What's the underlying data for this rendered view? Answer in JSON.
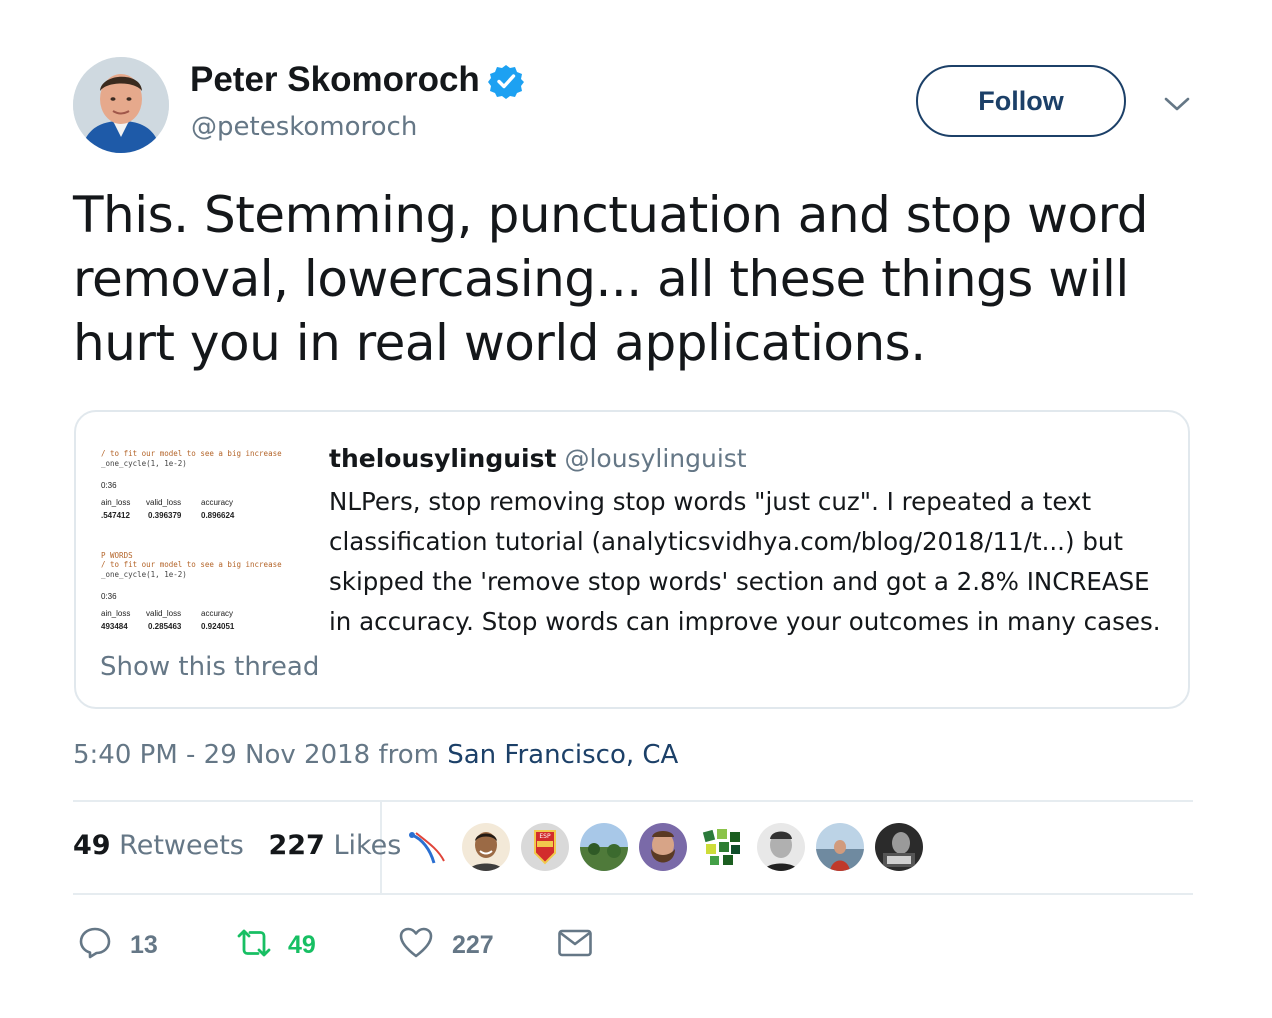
{
  "user": {
    "display_name": "Peter Skomoroch",
    "handle": "@peteskomoroch",
    "verified": true,
    "avatar_icon": "avatar-portrait"
  },
  "follow_button": {
    "label": "Follow"
  },
  "more_menu_icon": "chevron-down-icon",
  "tweet": {
    "text": "This. Stemming, punctuation and stop word removal, lowercasing... all these things will hurt you in real world applications."
  },
  "quote": {
    "author_name": "thelousylinguist",
    "author_handle": "@lousylinguist",
    "text": "NLPers, stop removing stop words \"just cuz\". I repeated a text classification tutorial (analyticsvidhya.com/blog/2018/11/t...) but skipped the 'remove stop words' section and got a 2.8% INCREASE in accuracy. Stop words can improve your outcomes in many cases.",
    "show_thread": "Show this thread",
    "media": {
      "block1": {
        "code_line1": "/ to fit our model to see a big increase",
        "code_line2": "_one_cycle(1, 1e-2)",
        "time": "0:36",
        "headers": [
          "ain_loss",
          "valid_loss",
          "accuracy"
        ],
        "values": [
          ".547412",
          "0.396379",
          "0.896624"
        ]
      },
      "block2": {
        "code_line0": "P WORDS",
        "code_line1": "/ to fit our model to see a big increase",
        "code_line2": "_one_cycle(1, 1e-2)",
        "time": "0:36",
        "headers": [
          "ain_loss",
          "valid_loss",
          "accuracy"
        ],
        "values": [
          "493484",
          "0.285463",
          "0.924051"
        ]
      }
    }
  },
  "meta": {
    "time": "5:40 PM - 29 Nov 2018",
    "from": "from",
    "location": "San Francisco, CA"
  },
  "stats": {
    "retweets_count": "49",
    "retweets_label": "Retweets",
    "likes_count": "227",
    "likes_label": "Likes"
  },
  "likers": [
    "liker-1",
    "liker-2",
    "liker-3",
    "liker-4",
    "liker-5",
    "liker-6",
    "liker-7",
    "liker-8",
    "liker-9"
  ],
  "actions": {
    "reply_count": "13",
    "retweet_count": "49",
    "like_count": "227"
  },
  "colors": {
    "link": "#1c4068",
    "secondary": "#657786",
    "retweet_green": "#17bf63",
    "verified_blue": "#1da1f2"
  }
}
